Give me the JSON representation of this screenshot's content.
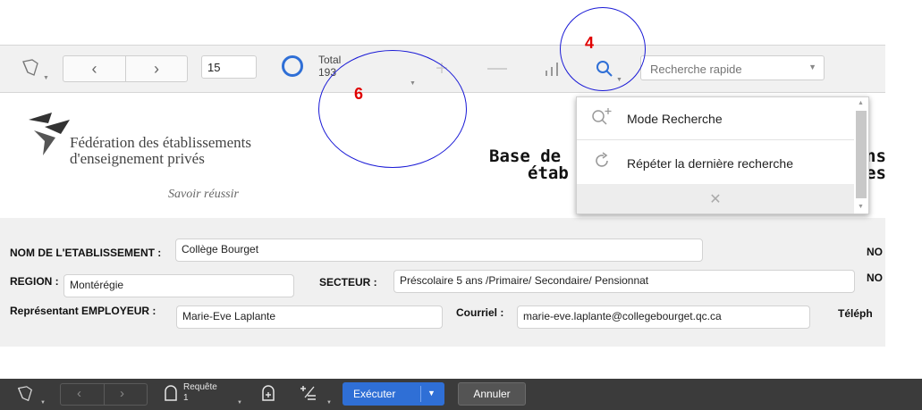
{
  "toolbar": {
    "layout_icon": "book-layout-icon",
    "prev_icon": "chevron-left-icon",
    "next_icon": "chevron-right-icon",
    "record_number": "15",
    "found_indicator": "found-set-ring-icon",
    "total_label": "Total",
    "total_count": "193",
    "add_icon": "plus-icon",
    "delete_icon": "minus-icon",
    "sort_icon": "sort-bars-icon",
    "search_icon": "magnifier-icon",
    "quick_search_placeholder": "Recherche rapide",
    "accent": "#2f6fd6"
  },
  "search_menu": {
    "items": [
      {
        "label": "Mode Recherche",
        "icon": "find-mode-icon"
      },
      {
        "label": "Répéter la dernière recherche",
        "icon": "repeat-icon"
      }
    ],
    "close_icon": "close-icon"
  },
  "header": {
    "org_line1": "Fédération des établissements",
    "org_line2": "d'enseignement privés",
    "motto": "Savoir réussir",
    "title_line1": "Base de",
    "title_line2": "étab",
    "title_right1": "ns",
    "title_right2": "es"
  },
  "form": {
    "establishment_label": "NOM DE L'ETABLISSEMENT :",
    "establishment_value": "Collège Bourget",
    "region_label": "REGION :",
    "region_value": "Montérégie",
    "sector_label": "SECTEUR :",
    "sector_value": "Préscolaire 5 ans /Primaire/ Secondaire/ Pensionnat",
    "employer_label": "Représentant EMPLOYEUR :",
    "employer_value": "Marie-Eve Laplante",
    "email_label": "Courriel :",
    "email_value": "marie-eve.laplante@collegebourget.qc.ca",
    "phone_label_partial": "Téléph",
    "right_label1": "NO",
    "right_label2": "NO"
  },
  "annotations": {
    "search_callout": "4",
    "total_callout": "6",
    "circle_color": "#1a1ad6",
    "number_color": "#e00000"
  },
  "bottom_bar": {
    "layout_icon": "book-layout-icon",
    "request_label": "Requête",
    "request_count": "1",
    "request_icon": "request-icon",
    "add_request_icon": "add-request-icon",
    "omit_icon": "omit-icon",
    "execute_label": "Exécuter",
    "cancel_label": "Annuler",
    "bg": "#3b3b3b"
  }
}
